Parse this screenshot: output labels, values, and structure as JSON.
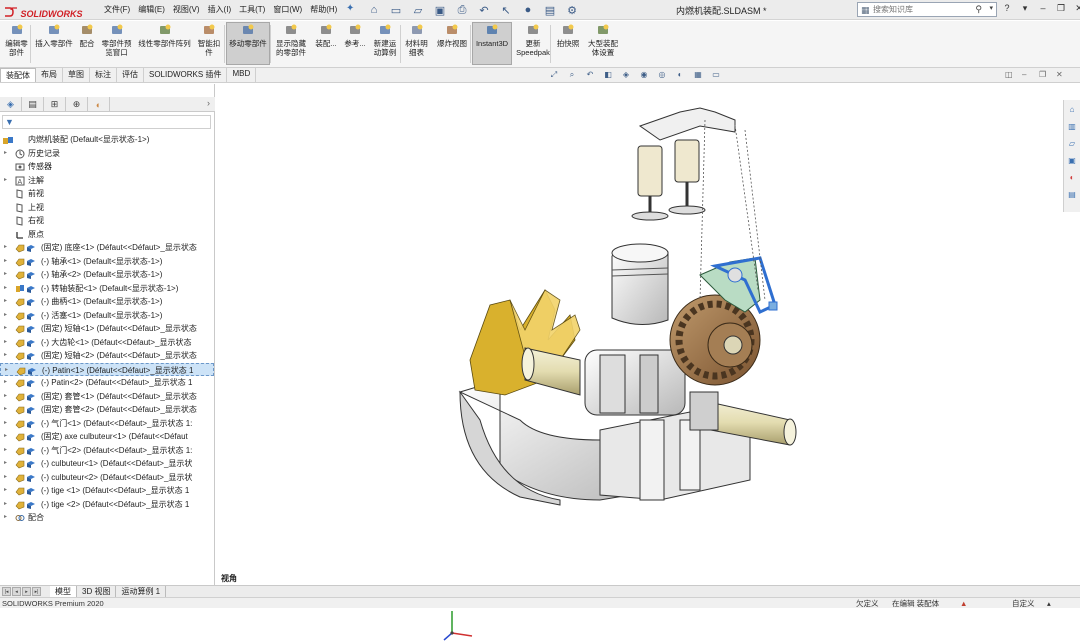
{
  "app": {
    "logo": "SOLIDWORKS",
    "doc_title": "内燃机装配.SLDASM *",
    "menus": [
      "文件(F)",
      "编辑(E)",
      "视图(V)",
      "插入(I)",
      "工具(T)",
      "窗口(W)",
      "帮助(H)"
    ],
    "search_placeholder": "搜索知识库",
    "accent": "#d11f25"
  },
  "ribbon": {
    "buttons": [
      {
        "label": "编辑零\n部件",
        "icon": "edit-component-icon"
      },
      {
        "label": "插入零部件",
        "icon": "insert-component-icon"
      },
      {
        "label": "配合",
        "icon": "mate-icon"
      },
      {
        "label": "零部件预\n览窗口",
        "icon": "preview-window-icon"
      },
      {
        "label": "线性零部件阵列",
        "icon": "linear-pattern-icon"
      },
      {
        "label": "智能扣\n件",
        "icon": "smart-fastener-icon"
      },
      {
        "label": "移动零部件",
        "icon": "move-component-icon"
      },
      {
        "label": "显示隐藏\n的零部件",
        "icon": "show-hidden-icon"
      },
      {
        "label": "装配...",
        "icon": "assembly-features-icon"
      },
      {
        "label": "参考...",
        "icon": "reference-geometry-icon"
      },
      {
        "label": "新建运\n动算例",
        "icon": "motion-study-icon"
      },
      {
        "label": "材料明\n细表",
        "icon": "bom-icon"
      },
      {
        "label": "爆炸视图",
        "icon": "exploded-view-icon"
      },
      {
        "label": "Instant3D",
        "icon": "instant3d-icon"
      },
      {
        "label": "更新\nSpeedpak",
        "icon": "speedpak-icon"
      },
      {
        "label": "拍快照",
        "icon": "snapshot-icon"
      },
      {
        "label": "大型装配\n体设置",
        "icon": "large-assembly-icon"
      }
    ]
  },
  "tabs": [
    "装配体",
    "布局",
    "草图",
    "标注",
    "评估",
    "SOLIDWORKS 插件",
    "MBD"
  ],
  "tree": {
    "root": "内燃机装配  (Default<显示状态-1>)",
    "items": [
      {
        "label": "历史记录",
        "icon": "history-icon",
        "exp": true
      },
      {
        "label": "传感器",
        "icon": "sensor-icon",
        "exp": false
      },
      {
        "label": "注解",
        "icon": "annotation-icon",
        "exp": true
      },
      {
        "label": "前视",
        "icon": "plane-icon",
        "exp": false
      },
      {
        "label": "上视",
        "icon": "plane-icon",
        "exp": false
      },
      {
        "label": "右视",
        "icon": "plane-icon",
        "exp": false
      },
      {
        "label": "原点",
        "icon": "origin-icon",
        "exp": false
      },
      {
        "label": "(固定) 底座<1> (Défaut<<Défaut>_显示状态",
        "icon": "part-icon",
        "exp": true
      },
      {
        "label": "(-) 轴承<1> (Default<显示状态-1>)",
        "icon": "part-icon",
        "exp": true
      },
      {
        "label": "(-) 轴承<2> (Default<显示状态-1>)",
        "icon": "part-icon",
        "exp": true
      },
      {
        "label": "(-) 转轴装配<1> (Default<显示状态-1>)",
        "icon": "subassembly-icon",
        "exp": true
      },
      {
        "label": "(-) 曲柄<1> (Default<显示状态-1>)",
        "icon": "part-icon",
        "exp": true
      },
      {
        "label": "(-) 活塞<1> (Default<显示状态-1>)",
        "icon": "part-icon",
        "exp": true
      },
      {
        "label": "(固定) 短轴<1> (Défaut<<Défaut>_显示状态",
        "icon": "part-icon",
        "exp": true
      },
      {
        "label": "(-) 大齿轮<1> (Défaut<<Défaut>_显示状态",
        "icon": "part-icon",
        "exp": true
      },
      {
        "label": "(固定) 短轴<2> (Défaut<<Défaut>_显示状态",
        "icon": "part-icon",
        "exp": true
      },
      {
        "label": "(-) Patin<1> (Défaut<<Défaut>_显示状态 1",
        "icon": "part-icon",
        "exp": true,
        "selected": true
      },
      {
        "label": "(-) Patin<2> (Défaut<<Défaut>_显示状态 1",
        "icon": "part-icon",
        "exp": true
      },
      {
        "label": "(固定) 套管<1> (Défaut<<Défaut>_显示状态",
        "icon": "part-icon",
        "exp": true
      },
      {
        "label": "(固定) 套管<2> (Défaut<<Défaut>_显示状态",
        "icon": "part-icon",
        "exp": true
      },
      {
        "label": "(-) 气门<1> (Défaut<<Défaut>_显示状态 1:",
        "icon": "part-icon",
        "exp": true
      },
      {
        "label": "(固定) axe culbuteur<1> (Défaut<<Défaut",
        "icon": "part-icon",
        "exp": true
      },
      {
        "label": "(-) 气门<2> (Défaut<<Défaut>_显示状态 1:",
        "icon": "part-icon",
        "exp": true
      },
      {
        "label": "(-) culbuteur<1> (Défaut<<Défaut>_显示状",
        "icon": "part-icon",
        "exp": true
      },
      {
        "label": "(-) culbuteur<2> (Défaut<<Défaut>_显示状",
        "icon": "part-icon",
        "exp": true
      },
      {
        "label": "(-) tige <1> (Défaut<<Défaut>_显示状态 1",
        "icon": "part-icon",
        "exp": true
      },
      {
        "label": "(-) tige <2> (Défaut<<Défaut>_显示状态 1",
        "icon": "part-icon",
        "exp": true
      },
      {
        "label": "配合",
        "icon": "mates-folder-icon",
        "exp": true
      }
    ]
  },
  "viewport": {
    "view_name": "视角"
  },
  "bottom_tabs": [
    "模型",
    "3D 视图",
    "运动算例 1"
  ],
  "status": {
    "product": "SOLIDWORKS Premium 2020",
    "underdefined": "欠定义",
    "editing": "在编辑 装配体",
    "custom": "自定义"
  }
}
